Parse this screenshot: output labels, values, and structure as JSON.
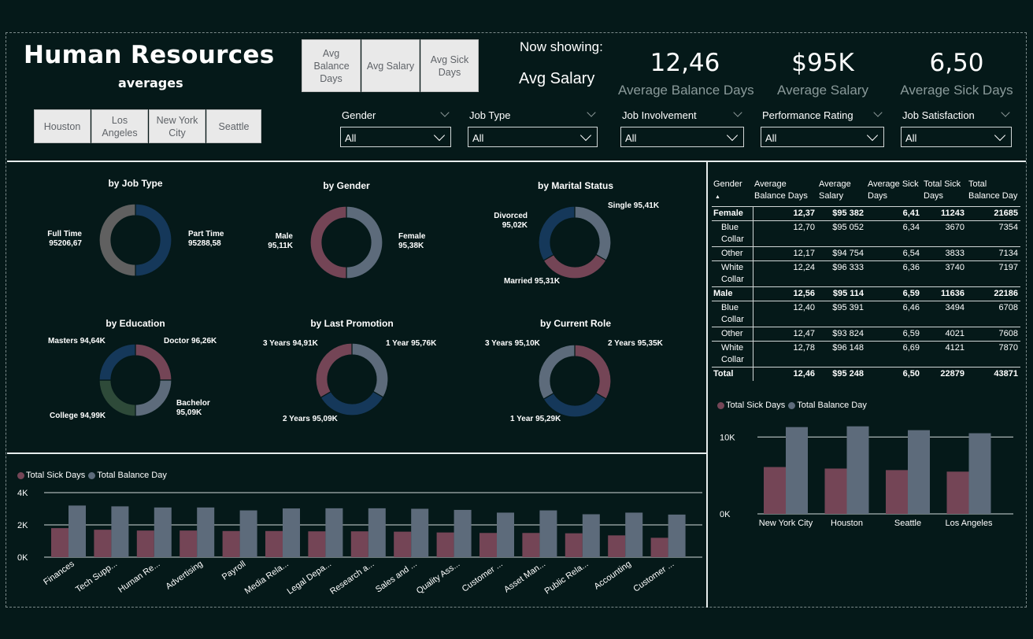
{
  "header": {
    "title": "Human Resources",
    "subtitle": "averages",
    "metric_buttons": [
      {
        "label": "Avg Balance Days"
      },
      {
        "label": "Avg Salary"
      },
      {
        "label": "Avg Sick Days"
      }
    ],
    "now_showing_label": "Now showing:",
    "now_showing_value": "Avg Salary",
    "city_buttons": [
      "Houston",
      "Los Angeles",
      "New York City",
      "Seattle"
    ]
  },
  "cards": [
    {
      "value": "12,46",
      "label": "Average Balance Days"
    },
    {
      "value": "$95K",
      "label": "Average Salary"
    },
    {
      "value": "6,50",
      "label": "Average Sick Days"
    }
  ],
  "slicers": [
    {
      "label": "Gender",
      "value": "All"
    },
    {
      "label": "Job Type",
      "value": "All"
    },
    {
      "label": "Job Involvement",
      "value": "All"
    },
    {
      "label": "Performance Rating",
      "value": "All"
    },
    {
      "label": "Job Satisfaction",
      "value": "All"
    }
  ],
  "colors": {
    "background": "#051919",
    "maroon": "#744556",
    "slate": "#5d6b7b",
    "navy": "#15385a",
    "green": "#2e4a39",
    "gray": "#606060"
  },
  "donuts": [
    {
      "title": "by Job Type",
      "segments": [
        {
          "name": "Part Time",
          "value": "95288,58",
          "share": 0.5
        },
        {
          "name": "Full Time",
          "value": "95206,67",
          "share": 0.5
        }
      ]
    },
    {
      "title": "by Gender",
      "segments": [
        {
          "name": "Female",
          "value": "95,38K",
          "share": 0.5
        },
        {
          "name": "Male",
          "value": "95,11K",
          "share": 0.5
        }
      ]
    },
    {
      "title": "by Marital Status",
      "segments": [
        {
          "name": "Single",
          "value": "95,41K",
          "share": 0.333
        },
        {
          "name": "Married",
          "value": "95,31K",
          "share": 0.333
        },
        {
          "name": "Divorced",
          "value": "95,02K",
          "share": 0.334
        }
      ]
    },
    {
      "title": "by Education",
      "segments": [
        {
          "name": "Doctor",
          "value": "96,26K",
          "share": 0.25
        },
        {
          "name": "Bachelor",
          "value": "95,09K",
          "share": 0.25
        },
        {
          "name": "College",
          "value": "94,99K",
          "share": 0.25
        },
        {
          "name": "Masters",
          "value": "94,64K",
          "share": 0.25
        }
      ]
    },
    {
      "title": "by Last Promotion",
      "segments": [
        {
          "name": "1 Year",
          "value": "95,76K",
          "share": 0.333
        },
        {
          "name": "2 Years",
          "value": "95,09K",
          "share": 0.333
        },
        {
          "name": "3 Years",
          "value": "94,91K",
          "share": 0.334
        }
      ]
    },
    {
      "title": "by Current Role",
      "segments": [
        {
          "name": "2 Years",
          "value": "95,35K",
          "share": 0.333
        },
        {
          "name": "1 Year",
          "value": "95,29K",
          "share": 0.333
        },
        {
          "name": "3 Years",
          "value": "95,10K",
          "share": 0.334
        }
      ]
    }
  ],
  "table": {
    "headers": [
      "Gender",
      "Average Balance Days",
      "Average Salary",
      "Average Sick Days",
      "Total Sick Days",
      "Total Balance Day"
    ],
    "rows": [
      {
        "kind": "grp",
        "cells": [
          "Female",
          "12,37",
          "$95 382",
          "6,41",
          "11243",
          "21685"
        ]
      },
      {
        "kind": "sub",
        "cells": [
          "Blue Collar",
          "12,70",
          "$95 052",
          "6,34",
          "3670",
          "7354"
        ]
      },
      {
        "kind": "sub",
        "cells": [
          "Other",
          "12,17",
          "$94 754",
          "6,54",
          "3833",
          "7134"
        ]
      },
      {
        "kind": "sub",
        "cells": [
          "White Collar",
          "12,24",
          "$96 333",
          "6,36",
          "3740",
          "7197"
        ]
      },
      {
        "kind": "grp",
        "cells": [
          "Male",
          "12,56",
          "$95 114",
          "6,59",
          "11636",
          "22186"
        ]
      },
      {
        "kind": "sub",
        "cells": [
          "Blue Collar",
          "12,40",
          "$95 391",
          "6,46",
          "3494",
          "6708"
        ]
      },
      {
        "kind": "sub",
        "cells": [
          "Other",
          "12,47",
          "$93 824",
          "6,59",
          "4021",
          "7608"
        ]
      },
      {
        "kind": "sub",
        "cells": [
          "White Collar",
          "12,78",
          "$96 148",
          "6,69",
          "4121",
          "7870"
        ]
      },
      {
        "kind": "tot",
        "cells": [
          "Total",
          "12,46",
          "$95 248",
          "6,50",
          "22879",
          "43871"
        ]
      }
    ]
  },
  "chart_data": [
    {
      "type": "bar",
      "legend": [
        "Total Sick Days",
        "Total Balance Day"
      ],
      "legend_position": "top-left",
      "categories": [
        "Finances",
        "Tech Supp...",
        "Human Re...",
        "Advertising",
        "Payroll",
        "Media Rela...",
        "Legal Depa...",
        "Research a...",
        "Sales and ...",
        "Quality Ass...",
        "Customer ...",
        "Asset Man...",
        "Public Rela...",
        "Accounting",
        "Customer ..."
      ],
      "series": [
        {
          "name": "Total Sick Days",
          "values": [
            1800,
            1700,
            1650,
            1650,
            1620,
            1620,
            1600,
            1600,
            1580,
            1530,
            1500,
            1500,
            1480,
            1350,
            1200
          ]
        },
        {
          "name": "Total Balance Day",
          "values": [
            3200,
            3150,
            3080,
            3080,
            2900,
            3020,
            3030,
            3030,
            3000,
            2930,
            2760,
            2900,
            2660,
            2760,
            2640
          ]
        }
      ],
      "y_ticks": [
        "0K",
        "2K",
        "4K"
      ],
      "ylim": [
        0,
        4000
      ],
      "grid": true
    },
    {
      "type": "bar",
      "legend": [
        "Total Sick Days",
        "Total Balance Day"
      ],
      "legend_position": "top-left",
      "categories": [
        "New York City",
        "Houston",
        "Seattle",
        "Los Angeles"
      ],
      "series": [
        {
          "name": "Total Sick Days",
          "values": [
            6100,
            5900,
            5700,
            5500
          ]
        },
        {
          "name": "Total Balance Day",
          "values": [
            11300,
            11400,
            10900,
            10500
          ]
        }
      ],
      "y_ticks": [
        "0K",
        "10K"
      ],
      "ylim": [
        0,
        12500
      ],
      "grid": true
    }
  ]
}
